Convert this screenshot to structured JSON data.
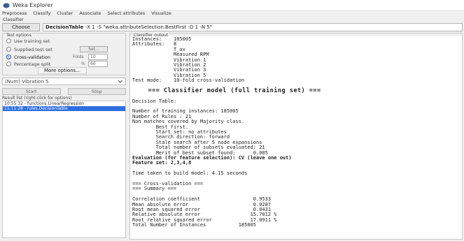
{
  "window": {
    "title": "Weka Explorer"
  },
  "tabs": [
    "Preprocess",
    "Classify",
    "Cluster",
    "Associate",
    "Select attributes",
    "Visualize"
  ],
  "classifier": {
    "section_label": "Classifier",
    "choose_label": "Choose",
    "name": "DecisionTable",
    "options": "-X 1 -S \"weka.attributeSelection.BestFirst -D 1 -N 5\""
  },
  "test_options": {
    "title": "Test options",
    "use_training": "Use training set",
    "supplied": "Supplied test set",
    "supplied_btn": "Set...",
    "cross_validation": "Cross-validation",
    "folds_label": "Folds",
    "folds_value": "10",
    "percentage": "Percentage split",
    "percent_label": "%",
    "percent_value": "66",
    "more_options": "More options..."
  },
  "class_attribute": "(Num) Vibration 5",
  "start_label": "Start",
  "stop_label": "Stop",
  "result_list": {
    "label": "Result list (right-click for options)",
    "items": [
      {
        "text": "10:55:32 - functions.LinearRegression",
        "selected": false
      },
      {
        "text": "11:11:28 - rules.DecisionTable",
        "selected": true
      }
    ]
  },
  "output": {
    "label": "Classifier output",
    "lines": [
      {
        "text": "Instances:    185005",
        "cls": ""
      },
      {
        "text": "Attributes:   8",
        "cls": ""
      },
      {
        "text": "              T_ax",
        "cls": ""
      },
      {
        "text": "              Measured RPM",
        "cls": ""
      },
      {
        "text": "              Vibration 1",
        "cls": ""
      },
      {
        "text": "              Vibration 2",
        "cls": ""
      },
      {
        "text": "              Vibration 3",
        "cls": ""
      },
      {
        "text": "              Vibration 5",
        "cls": ""
      },
      {
        "text": "Test mode:    10-fold cross-validation",
        "cls": ""
      },
      {
        "text": "",
        "cls": ""
      },
      {
        "text": "    === Classifier model (full training set) ===",
        "cls": "big"
      },
      {
        "text": "",
        "cls": ""
      },
      {
        "text": "Decision Table:",
        "cls": ""
      },
      {
        "text": "",
        "cls": ""
      },
      {
        "text": "Number of training instances: 185005",
        "cls": ""
      },
      {
        "text": "Number of Rules : 21",
        "cls": ""
      },
      {
        "text": "Non matches covered by Majority class.",
        "cls": ""
      },
      {
        "text": "        Best first.",
        "cls": ""
      },
      {
        "text": "        Start set: no attributes",
        "cls": ""
      },
      {
        "text": "        Search direction: forward",
        "cls": ""
      },
      {
        "text": "        Stale search after 5 node expansions",
        "cls": ""
      },
      {
        "text": "        Total number of subsets evaluated: 21",
        "cls": ""
      },
      {
        "text": "        Merit of best subset found:      0.005",
        "cls": ""
      },
      {
        "text": "Evaluation (for feature selection): CV (leave one out)",
        "cls": "bold"
      },
      {
        "text": "Feature set: 2,3,4,8",
        "cls": "bold"
      },
      {
        "text": "",
        "cls": ""
      },
      {
        "text": "Time taken to build model: 4.15 seconds",
        "cls": ""
      },
      {
        "text": "",
        "cls": ""
      },
      {
        "text": "=== Cross-validation ===",
        "cls": ""
      },
      {
        "text": "=== Summary ===",
        "cls": ""
      },
      {
        "text": "",
        "cls": ""
      },
      {
        "text": "Correlation coefficient                  0.9533",
        "cls": ""
      },
      {
        "text": "Mean absolute error                      0.0287",
        "cls": ""
      },
      {
        "text": "Root mean squared error                  0.0431",
        "cls": ""
      },
      {
        "text": "Relative absolute error                 15.7012 %",
        "cls": ""
      },
      {
        "text": "Root relative squared error             17.0911 %",
        "cls": ""
      },
      {
        "text": "Total Number of Instances           185005",
        "cls": ""
      }
    ]
  }
}
